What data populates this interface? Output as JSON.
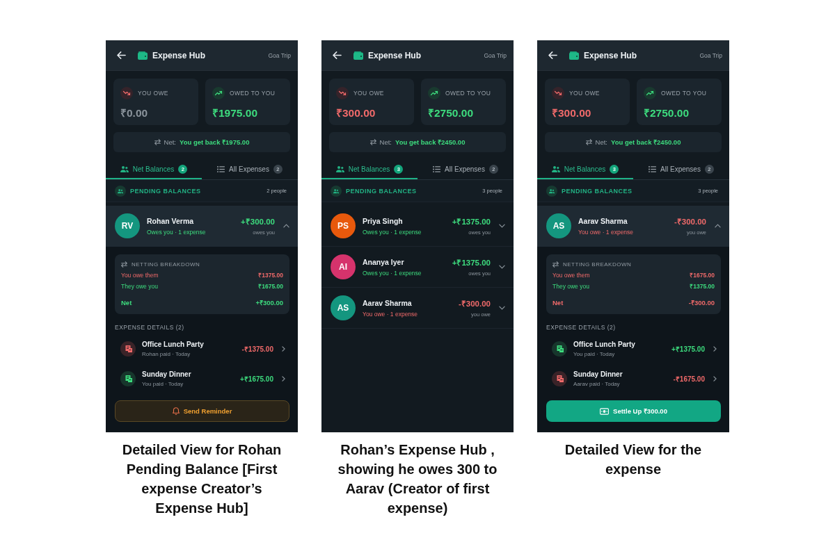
{
  "screens": [
    {
      "header": {
        "title": "Expense Hub",
        "trip": "Goa Trip"
      },
      "summary": [
        {
          "kind": "owe",
          "label": "YOU OWE",
          "amount": "₹0.00",
          "muted": true
        },
        {
          "kind": "owed",
          "label": "OWED TO YOU",
          "amount": "₹1975.00",
          "muted": false
        }
      ],
      "net": {
        "label": "Net:",
        "value": "You get back ₹1975.00"
      },
      "tabs": [
        {
          "kind": "balances",
          "label": "Net Balances",
          "badge": "2",
          "selected": true
        },
        {
          "kind": "expenses",
          "label": "All Expenses",
          "badge": "2",
          "selected": false
        }
      ],
      "section": {
        "title": "PENDING BALANCES",
        "count": "2 people"
      },
      "people": [
        {
          "kind": "credit",
          "initials": "RV",
          "name": "Rohan Verma",
          "color": "#14967f",
          "status": "Owes you · 1 expense",
          "amount": "+₹300.00",
          "note": "owes you",
          "expanded": true,
          "breakdown": {
            "title": "NETTING BREAKDOWN",
            "rows": [
              {
                "kind": "debit",
                "label": "You owe them",
                "amount": "₹1375.00"
              },
              {
                "kind": "credit",
                "label": "They owe you",
                "amount": "₹1675.00"
              }
            ],
            "net": {
              "kind": "credit",
              "label": "Net",
              "amount": "+₹300.00"
            }
          },
          "expenses_title": "EXPENSE DETAILS (2)",
          "expenses": [
            {
              "kind": "debit",
              "title": "Office Lunch Party",
              "meta": "Rohan paid · Today",
              "amount": "-₹1375.00"
            },
            {
              "kind": "credit",
              "title": "Sunday Dinner",
              "meta": "You paid · Today",
              "amount": "+₹1675.00"
            }
          ],
          "action": {
            "kind": "reminder",
            "label": "Send Reminder"
          }
        }
      ],
      "caption": "Detailed View for Rohan Pending Balance [First expense Creator’s Expense Hub]"
    },
    {
      "header": {
        "title": "Expense Hub",
        "trip": "Goa Trip"
      },
      "summary": [
        {
          "kind": "owe",
          "label": "YOU OWE",
          "amount": "₹300.00",
          "muted": false
        },
        {
          "kind": "owed",
          "label": "OWED TO YOU",
          "amount": "₹2750.00",
          "muted": false
        }
      ],
      "net": {
        "label": "Net:",
        "value": "You get back ₹2450.00"
      },
      "tabs": [
        {
          "kind": "balances",
          "label": "Net Balances",
          "badge": "3",
          "selected": true
        },
        {
          "kind": "expenses",
          "label": "All Expenses",
          "badge": "2",
          "selected": false
        }
      ],
      "section": {
        "title": "PENDING BALANCES",
        "count": "3 people"
      },
      "people": [
        {
          "kind": "credit",
          "initials": "PS",
          "name": "Priya Singh",
          "color": "#e8590c",
          "status": "Owes you · 1 expense",
          "amount": "+₹1375.00",
          "note": "owes you",
          "expanded": false
        },
        {
          "kind": "credit",
          "initials": "AI",
          "name": "Ananya Iyer",
          "color": "#d6336c",
          "status": "Owes you · 1 expense",
          "amount": "+₹1375.00",
          "note": "owes you",
          "expanded": false
        },
        {
          "kind": "debit",
          "initials": "AS",
          "name": "Aarav Sharma",
          "color": "#14967f",
          "status": "You owe · 1 expense",
          "amount": "-₹300.00",
          "note": "you owe",
          "expanded": false
        }
      ],
      "caption": "Rohan’s Expense Hub , showing he owes 300 to Aarav (Creator of first expense)"
    },
    {
      "header": {
        "title": "Expense Hub",
        "trip": "Goa Trip"
      },
      "summary": [
        {
          "kind": "owe",
          "label": "YOU OWE",
          "amount": "₹300.00",
          "muted": false
        },
        {
          "kind": "owed",
          "label": "OWED TO YOU",
          "amount": "₹2750.00",
          "muted": false
        }
      ],
      "net": {
        "label": "Net:",
        "value": "You get back ₹2450.00"
      },
      "tabs": [
        {
          "kind": "balances",
          "label": "Net Balances",
          "badge": "3",
          "selected": true
        },
        {
          "kind": "expenses",
          "label": "All Expenses",
          "badge": "2",
          "selected": false
        }
      ],
      "section": {
        "title": "PENDING BALANCES",
        "count": "3 people"
      },
      "people": [
        {
          "kind": "debit",
          "initials": "AS",
          "name": "Aarav Sharma",
          "color": "#14967f",
          "status": "You owe · 1 expense",
          "amount": "-₹300.00",
          "note": "you owe",
          "expanded": true,
          "breakdown": {
            "title": "NETTING BREAKDOWN",
            "rows": [
              {
                "kind": "debit",
                "label": "You owe them",
                "amount": "₹1675.00"
              },
              {
                "kind": "credit",
                "label": "They owe you",
                "amount": "₹1375.00"
              }
            ],
            "net": {
              "kind": "debit",
              "label": "Net",
              "amount": "-₹300.00"
            }
          },
          "expenses_title": "EXPENSE DETAILS (2)",
          "expenses": [
            {
              "kind": "credit",
              "title": "Office Lunch Party",
              "meta": "You paid · Today",
              "amount": "+₹1375.00"
            },
            {
              "kind": "debit",
              "title": "Sunday Dinner",
              "meta": "Aarav paid · Today",
              "amount": "-₹1675.00"
            }
          ],
          "action": {
            "kind": "settle",
            "label": "Settle Up ₹300.00"
          }
        }
      ],
      "caption": "Detailed View for the expense"
    }
  ]
}
